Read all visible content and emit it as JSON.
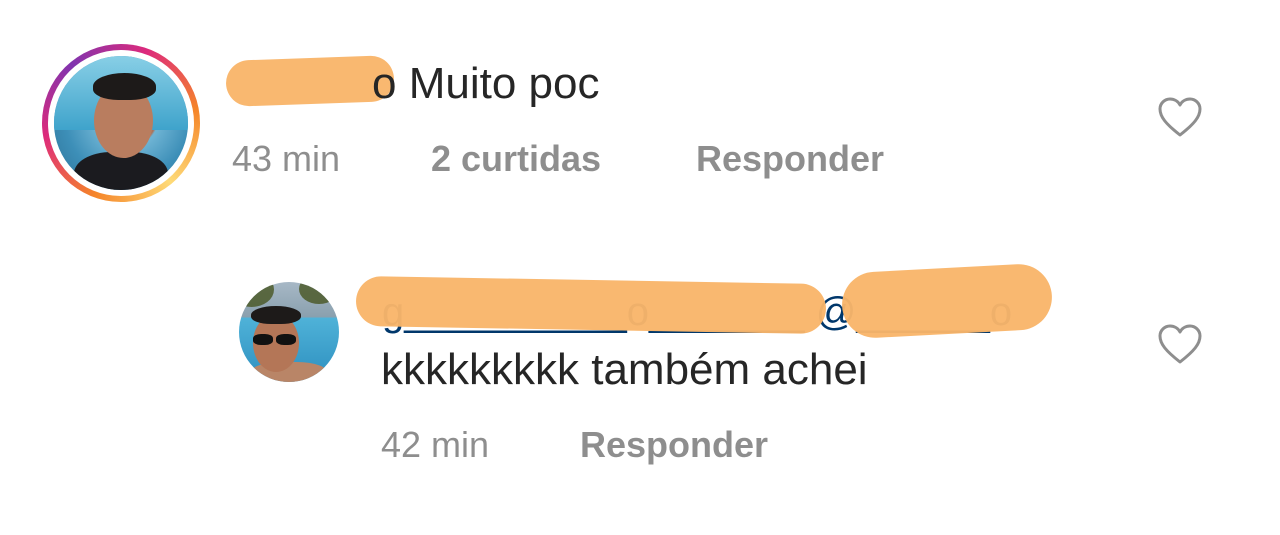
{
  "comments": [
    {
      "text": "o Muito poc",
      "time": "43 min",
      "likes": "2 curtidas",
      "reply": "Responder"
    },
    {
      "mention_hint": "g__________o_______ @______o",
      "text": "kkkkkkkkk também achei",
      "time": "42 min",
      "reply": "Responder"
    }
  ],
  "icons": {
    "like": "heart-outline-icon"
  },
  "colors": {
    "redaction": "#f9b56a",
    "muted_text": "#8e8e8e",
    "mention": "#00376b",
    "story_ring": "#dd2a7b"
  }
}
